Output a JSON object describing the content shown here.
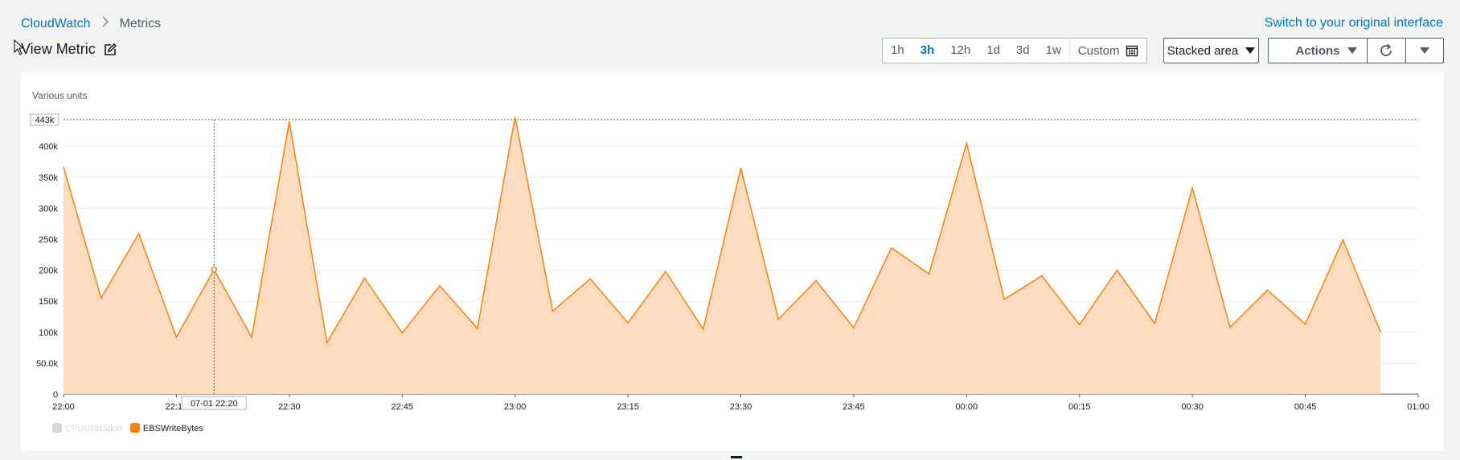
{
  "breadcrumb": {
    "root": "CloudWatch",
    "separator": ">",
    "current": "Metrics"
  },
  "switch_link": "Switch to your original interface",
  "page_title": "View Metric",
  "time_ranges": [
    {
      "label": "1h",
      "active": false
    },
    {
      "label": "3h",
      "active": true
    },
    {
      "label": "12h",
      "active": false
    },
    {
      "label": "1d",
      "active": false
    },
    {
      "label": "3d",
      "active": false
    },
    {
      "label": "1w",
      "active": false
    }
  ],
  "custom_label": "Custom",
  "view_type_label": "Stacked area",
  "actions_label": "Actions",
  "icons": {
    "edit": "edit-icon",
    "calendar": "calendar-icon",
    "refresh": "refresh-icon",
    "dropdown": "chevron-down-icon"
  },
  "colors": {
    "link": "#0073bb",
    "series": "#ff7f0e",
    "series_fill": "#fddcc0",
    "legend_disabled": "#d5dbdb"
  },
  "chart_data": {
    "type": "area",
    "ylabel": "Various units",
    "y_ticks": [
      "0",
      "50.0k",
      "100k",
      "150k",
      "200k",
      "250k",
      "300k",
      "350k",
      "400k"
    ],
    "ylim": [
      0,
      443000
    ],
    "max_marker": "443k",
    "x_ticks": [
      "22:00",
      "22:15",
      "22:30",
      "22:45",
      "23:00",
      "23:15",
      "23:30",
      "23:45",
      "00:00",
      "00:15",
      "00:30",
      "00:45",
      "01:00"
    ],
    "tooltip": {
      "label": "07-01 22:20",
      "x_index": 4
    },
    "x_points": [
      "22:00",
      "22:05",
      "22:10",
      "22:15",
      "22:20",
      "22:25",
      "22:30",
      "22:35",
      "22:40",
      "22:45",
      "22:50",
      "22:55",
      "23:00",
      "23:05",
      "23:10",
      "23:15",
      "23:20",
      "23:25",
      "23:30",
      "23:35",
      "23:40",
      "23:45",
      "23:50",
      "23:55",
      "00:00",
      "00:05",
      "00:10",
      "00:15",
      "00:20",
      "00:25",
      "00:30",
      "00:35",
      "00:40",
      "00:45",
      "00:50",
      "00:55"
    ],
    "series": [
      {
        "name": "CPUUtilization",
        "enabled": false,
        "values": []
      },
      {
        "name": "EBSWriteBytes",
        "enabled": true,
        "values": [
          367000,
          155000,
          259000,
          92000,
          201000,
          92000,
          440000,
          83000,
          187000,
          99000,
          175000,
          106000,
          447000,
          134000,
          186000,
          115000,
          198000,
          105000,
          365000,
          121000,
          183000,
          107000,
          236000,
          194000,
          405000,
          153000,
          191000,
          112000,
          200000,
          114000,
          333000,
          108000,
          168000,
          113000,
          249000,
          100000
        ]
      }
    ],
    "grid": true,
    "legend_position": "bottom-left"
  }
}
